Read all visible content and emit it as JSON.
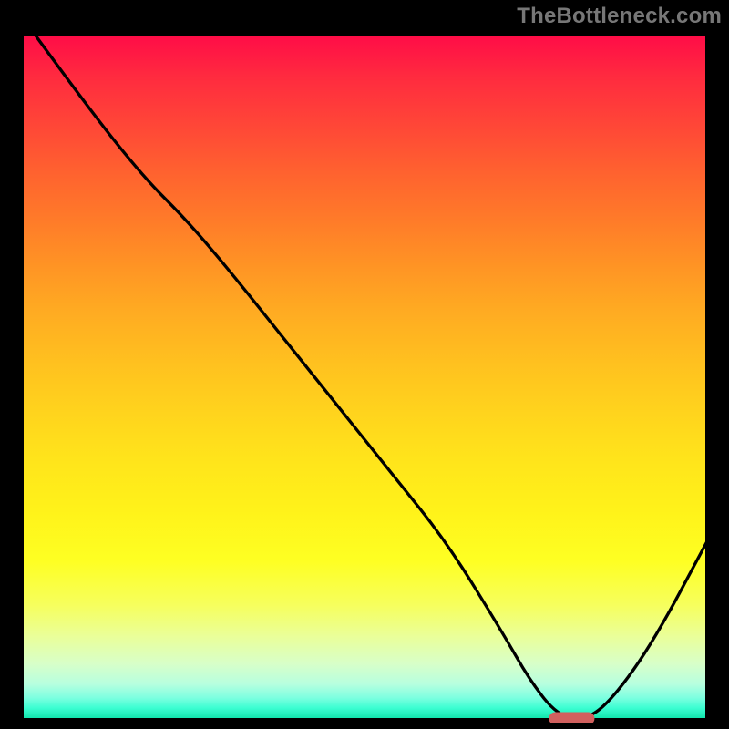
{
  "watermark": "TheBottleneck.com",
  "chart_data": {
    "type": "line",
    "title": "",
    "xlabel": "",
    "ylabel": "",
    "xlim": [
      0,
      100
    ],
    "ylim": [
      0,
      100
    ],
    "grid": false,
    "legend": false,
    "background_gradient": {
      "top_color": "#ff0d47",
      "bottom_color": "#12e6ae",
      "description": "vertical rainbow gradient red→orange→yellow→green"
    },
    "series": [
      {
        "name": "bottleneck-curve",
        "x": [
          2,
          10,
          18,
          24,
          30,
          38,
          46,
          54,
          62,
          70,
          74,
          78,
          82,
          86,
          92,
          100
        ],
        "y": [
          100,
          89,
          79,
          73,
          66,
          56,
          46,
          36,
          26,
          13,
          6,
          1,
          0.3,
          3.5,
          12,
          27
        ],
        "color": "#000000"
      }
    ],
    "marker": {
      "name": "optimal-range",
      "shape": "rounded-bar",
      "x_center": 80,
      "y": 0.6,
      "width_x": 6.6,
      "color": "#d1605e"
    }
  }
}
